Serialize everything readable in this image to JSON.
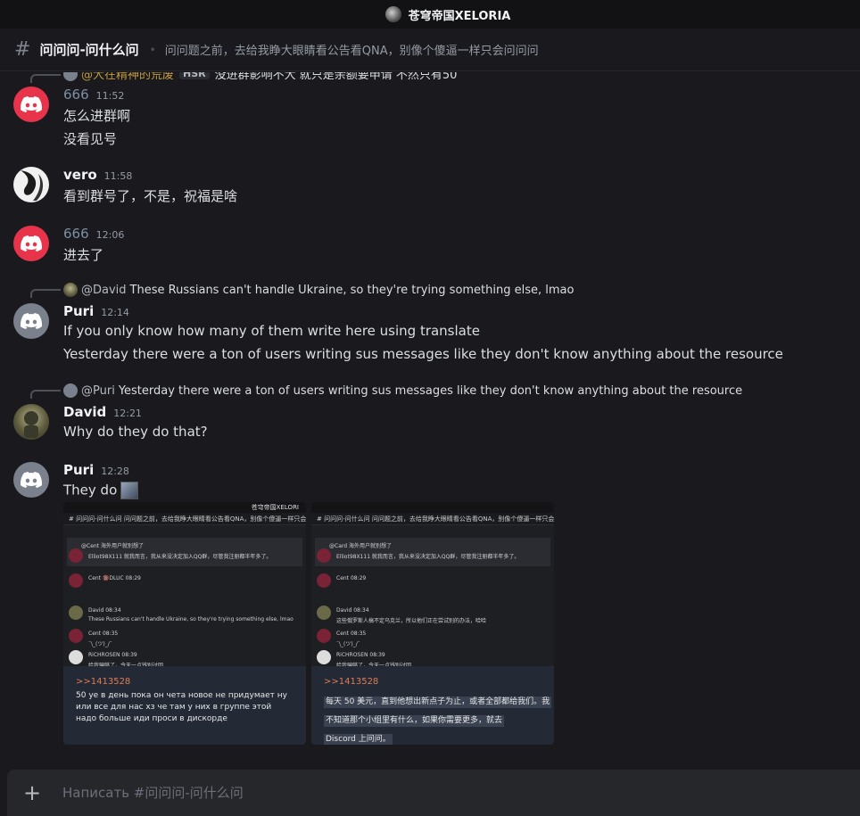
{
  "server": {
    "name": "苍穹帝国XELORIA",
    "icon": "server-avatar-icon"
  },
  "channel": {
    "name": "问问问-问什么问",
    "topic": "问问题之前，去给我睁大眼睛看公告看QNA，别像个傻逼一样只会问问问"
  },
  "messages": [
    {
      "reply": {
        "name": "@大在精神的荒废",
        "badge": "HSR",
        "text": "没进群影响不大 就只是余额要申请 不然只有50"
      },
      "author": "666",
      "time": "11:52",
      "lines": [
        "怎么进群啊",
        "没看见号"
      ]
    },
    {
      "author": "vero",
      "time": "11:58",
      "lines": [
        "看到群号了，不是，祝福是啥"
      ]
    },
    {
      "author": "666",
      "time": "12:06",
      "lines": [
        "进去了"
      ]
    },
    {
      "reply": {
        "name": "@David",
        "text": "These Russians can't handle Ukraine, so they're trying something else, lmao"
      },
      "author": "Puri",
      "time": "12:14",
      "lines": [
        "If you only know how many of them write here using translate",
        "Yesterday there were a ton of users writing sus messages like they don't know anything about the resource"
      ]
    },
    {
      "reply": {
        "name": "@Puri",
        "text": "Yesterday there were a ton of users writing sus messages like they don't know anything about the resource"
      },
      "author": "David",
      "time": "12:21",
      "lines": [
        "Why do they do that?"
      ]
    },
    {
      "author": "Puri",
      "time": "12:28",
      "lines": [
        "They do"
      ]
    }
  ],
  "attachments": [
    {
      "server": "苍穹帝国XELORI",
      "header": "# 问问问-问什么问  问问题之前，去给我睁大眼睛看公告看QNA，别像个傻逼一样只会问问问",
      "rows": [
        "@Cent  海外用户就别想了",
        "Elliot98X111  就我而言，我从来没决定加入QQ群，尽管我注册都半年多了。",
        "Cent  🔞DLUC  08:29",
        "David  08:34",
        "These Russians can't handle Ukraine, so they're trying something else, lmao",
        "Cent  08:35",
        "¯\\_(ツ)_/¯",
        "RiCHROSEN  08:39",
        "给我骗够了，今天一点钱别讨回"
      ],
      "quote_id": ">>1413528",
      "quote_lines": [
        "50 уе в день пока он чета новое не придумает ну",
        "или все для нас хз че там у них в группе этой",
        "надо больше иди проси в дискорде"
      ]
    },
    {
      "server": "",
      "header": "# 问问问-问什么问  问问题之前，去给我睁大眼睛看公告看QNA，别像个傻逼一样只会问问问",
      "rows": [
        "@Card  海外用户就别想了",
        "Elliot98X111  就我而言，我从来没决定加入QQ群，尽管我注册都半年多了。",
        "Cent  08:29",
        "David  08:34",
        "这些俄罗斯人搞不定乌克兰，所以他们正在尝试别的办法，哈哈",
        "Cent  08:35",
        "¯\\_(ツ)_/¯",
        "RiCHROSEN  08:39",
        "给我骗够了，今天一点钱别讨回"
      ],
      "quote_id": ">>1413528",
      "quote_lines": [
        "每天 50 美元，直到他想出新点子为止，或者全部都给我们。我",
        "不知道那个小组里有什么，如果你需要更多，就去",
        "Discord 上问问。"
      ]
    }
  ],
  "composer": {
    "placeholder": "Написать #问问问-问什么问"
  },
  "colors": {
    "discord_red": "#e8344b",
    "background": "#1a1a1e",
    "accent_gold": "#c29b3a"
  }
}
